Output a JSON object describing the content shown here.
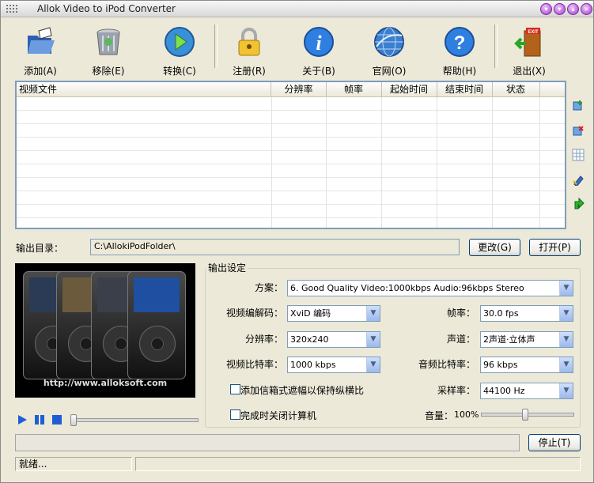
{
  "window": {
    "title": "Allok Video to iPod Converter"
  },
  "toolbar": {
    "add": "添加(A)",
    "remove": "移除(E)",
    "convert": "转换(C)",
    "register": "注册(R)",
    "about": "关于(B)",
    "website": "官网(O)",
    "help": "帮助(H)",
    "exit": "退出(X)",
    "exit_sign": "EXIT"
  },
  "file_list": {
    "columns": [
      "视频文件",
      "分辨率",
      "帧率",
      "起始时间",
      "结束时间",
      "状态"
    ],
    "rows": []
  },
  "output": {
    "label": "输出目录：",
    "path": "C:\\AllokiPodFolder\\",
    "change_button": "更改(G)",
    "open_button": "打开(P)"
  },
  "preview": {
    "url": "http://www.alloksoft.com"
  },
  "settings": {
    "title": "输出设定",
    "profile_label": "方案：",
    "profile_value": "6. Good   Quality  Video:1000kbps  Audio:96kbps   Stereo",
    "video_codec_label": "视频编解码：",
    "video_codec_value": "XviD 编码",
    "frame_rate_label": "帧率：",
    "frame_rate_value": "30.0   fps",
    "resolution_label": "分辨率：",
    "resolution_value": "320x240",
    "channels_label": "声道：",
    "channels_value": "2声道·立体声",
    "video_bitrate_label": "视频比特率：",
    "video_bitrate_value": "1000 kbps",
    "audio_bitrate_label": "音频比特率：",
    "audio_bitrate_value": "96  kbps",
    "letterbox_label": "添加信箱式遮幅以保持纵横比",
    "sample_rate_label": "采样率：",
    "sample_rate_value": "44100 Hz",
    "shutdown_label": "完成时关闭计算机",
    "volume_label": "音量：",
    "volume_value": "100%",
    "volume_level": 1.0
  },
  "progress": {
    "stop_button": "停止(T)",
    "value": 0
  },
  "status": {
    "text": "就绪..."
  },
  "colors": {
    "accent": "#7f9db9",
    "window_bg": "#ece9d8",
    "play_blue": "#1f5fd6"
  }
}
